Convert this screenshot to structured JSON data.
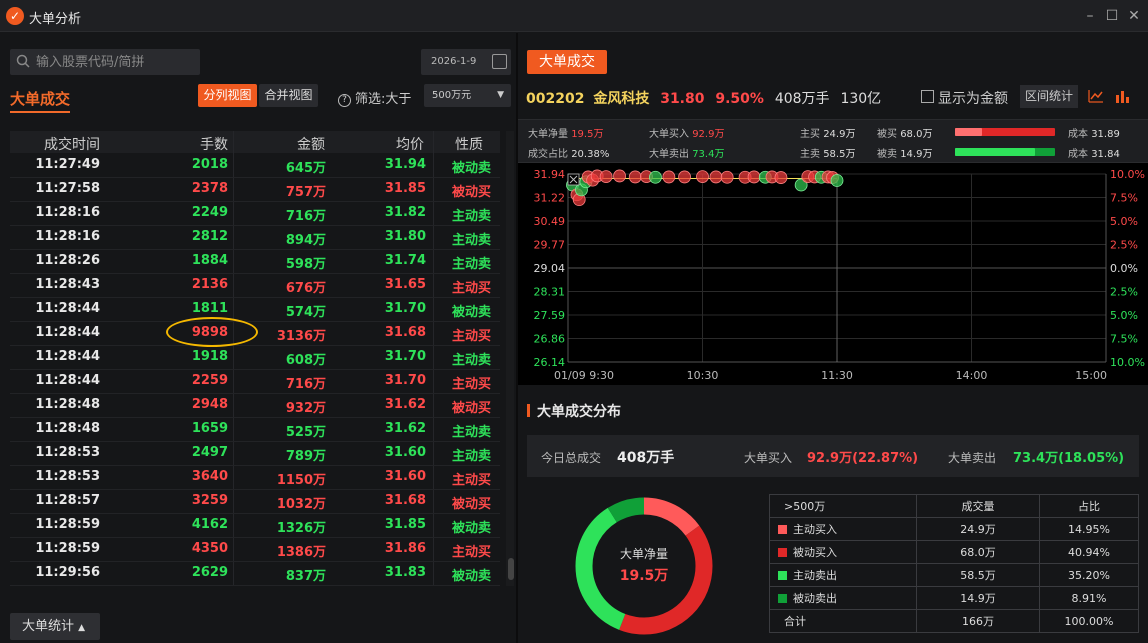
{
  "window": {
    "title": "大单分析",
    "logo_glyph": "✓",
    "controls": [
      "–",
      "☐",
      "✕"
    ]
  },
  "left": {
    "search": {
      "placeholder": "输入股票代码/简拼"
    },
    "date": "2026-1-9",
    "title": "大单成交",
    "view_split": "分列视图",
    "view_merge": "合并视图",
    "filter_label": "筛选:大于",
    "filter_value": "500万元",
    "columns": [
      "成交时间",
      "手数",
      "金额",
      "均价",
      "性质"
    ],
    "rows": [
      {
        "time": "11:27:49",
        "vol": "2018",
        "amt": "645万",
        "price": "31.94",
        "kind": "被动卖",
        "c": "green"
      },
      {
        "time": "11:27:58",
        "vol": "2378",
        "amt": "757万",
        "price": "31.85",
        "kind": "被动买",
        "c": "red"
      },
      {
        "time": "11:28:16",
        "vol": "2249",
        "amt": "716万",
        "price": "31.82",
        "kind": "主动卖",
        "c": "green"
      },
      {
        "time": "11:28:16",
        "vol": "2812",
        "amt": "894万",
        "price": "31.80",
        "kind": "主动卖",
        "c": "green"
      },
      {
        "time": "11:28:26",
        "vol": "1884",
        "amt": "598万",
        "price": "31.74",
        "kind": "主动卖",
        "c": "green"
      },
      {
        "time": "11:28:43",
        "vol": "2136",
        "amt": "676万",
        "price": "31.65",
        "kind": "主动买",
        "c": "red"
      },
      {
        "time": "11:28:44",
        "vol": "1811",
        "amt": "574万",
        "price": "31.70",
        "kind": "被动卖",
        "c": "green"
      },
      {
        "time": "11:28:44",
        "vol": "9898",
        "amt": "3136万",
        "price": "31.68",
        "kind": "主动买",
        "c": "red"
      },
      {
        "time": "11:28:44",
        "vol": "1918",
        "amt": "608万",
        "price": "31.70",
        "kind": "主动卖",
        "c": "green"
      },
      {
        "time": "11:28:44",
        "vol": "2259",
        "amt": "716万",
        "price": "31.70",
        "kind": "主动买",
        "c": "red"
      },
      {
        "time": "11:28:48",
        "vol": "2948",
        "amt": "932万",
        "price": "31.62",
        "kind": "被动买",
        "c": "red"
      },
      {
        "time": "11:28:48",
        "vol": "1659",
        "amt": "525万",
        "price": "31.62",
        "kind": "主动卖",
        "c": "green"
      },
      {
        "time": "11:28:53",
        "vol": "2497",
        "amt": "789万",
        "price": "31.60",
        "kind": "主动卖",
        "c": "green"
      },
      {
        "time": "11:28:53",
        "vol": "3640",
        "amt": "1150万",
        "price": "31.60",
        "kind": "主动买",
        "c": "red"
      },
      {
        "time": "11:28:57",
        "vol": "3259",
        "amt": "1032万",
        "price": "31.68",
        "kind": "被动买",
        "c": "red"
      },
      {
        "time": "11:28:59",
        "vol": "4162",
        "amt": "1326万",
        "price": "31.85",
        "kind": "被动卖",
        "c": "green"
      },
      {
        "time": "11:28:59",
        "vol": "4350",
        "amt": "1386万",
        "price": "31.86",
        "kind": "主动买",
        "c": "red"
      },
      {
        "time": "11:29:56",
        "vol": "2629",
        "amt": "837万",
        "price": "31.83",
        "kind": "被动卖",
        "c": "green"
      }
    ],
    "stat_button": "大单统计"
  },
  "right": {
    "title_button": "大单成交",
    "stock": {
      "code": "002202",
      "name": "金风科技",
      "price": "31.80",
      "change": "9.50%",
      "volume": "408万手",
      "cap": "130亿"
    },
    "show_amount_label": "显示为金额",
    "range_stat_label": "区间统计",
    "info": {
      "net_label": "大单净量",
      "net": "19.5万",
      "ratio_label": "成交占比",
      "ratio": "20.38%",
      "buy_label": "大单买入",
      "buy": "92.9万",
      "sell_label": "大单卖出",
      "sell": "73.4万",
      "active_buy_label": "主买",
      "active_buy": "24.9万",
      "passive_buy_label": "被买",
      "passive_buy": "68.0万",
      "active_sell_label": "主卖",
      "active_sell": "58.5万",
      "passive_sell_label": "被卖",
      "passive_sell": "14.9万",
      "cost_label": "成本",
      "cost_buy": "31.89",
      "cost_sell": "31.84",
      "buy_bar_active_fraction": 0.27,
      "sell_bar_active_fraction": 0.8
    },
    "chart_data": {
      "type": "scatter",
      "y_ticks": [
        "31.94",
        "31.22",
        "30.49",
        "29.77",
        "29.04",
        "28.31",
        "27.59",
        "26.86",
        "26.14"
      ],
      "pct_ticks": [
        "10.0%",
        "7.5%",
        "5.0%",
        "2.5%",
        "0.0%",
        "2.5%",
        "5.0%",
        "7.5%",
        "10.0%"
      ],
      "x_ticks": [
        "01/09 9:30",
        "10:30",
        "11:30",
        "14:00",
        "15:00"
      ],
      "ylim": [
        26.14,
        31.94
      ],
      "xlim": [
        0,
        240
      ],
      "price_line": 31.8,
      "points": [
        {
          "t": 2,
          "p": 31.6,
          "s": "sell"
        },
        {
          "t": 4,
          "p": 31.3,
          "s": "buy"
        },
        {
          "t": 5,
          "p": 31.15,
          "s": "buy"
        },
        {
          "t": 6,
          "p": 31.45,
          "s": "sell"
        },
        {
          "t": 8,
          "p": 31.7,
          "s": "sell"
        },
        {
          "t": 9,
          "p": 31.85,
          "s": "buy"
        },
        {
          "t": 11,
          "p": 31.75,
          "s": "buy"
        },
        {
          "t": 13,
          "p": 31.88,
          "s": "buy"
        },
        {
          "t": 17,
          "p": 31.86,
          "s": "buy"
        },
        {
          "t": 23,
          "p": 31.88,
          "s": "buy"
        },
        {
          "t": 30,
          "p": 31.85,
          "s": "buy"
        },
        {
          "t": 35,
          "p": 31.86,
          "s": "buy"
        },
        {
          "t": 39,
          "p": 31.84,
          "s": "sell"
        },
        {
          "t": 45,
          "p": 31.85,
          "s": "buy"
        },
        {
          "t": 52,
          "p": 31.85,
          "s": "buy"
        },
        {
          "t": 60,
          "p": 31.86,
          "s": "buy"
        },
        {
          "t": 66,
          "p": 31.85,
          "s": "buy"
        },
        {
          "t": 71,
          "p": 31.84,
          "s": "buy"
        },
        {
          "t": 79,
          "p": 31.84,
          "s": "buy"
        },
        {
          "t": 83,
          "p": 31.85,
          "s": "buy"
        },
        {
          "t": 88,
          "p": 31.84,
          "s": "sell"
        },
        {
          "t": 91,
          "p": 31.85,
          "s": "buy"
        },
        {
          "t": 95,
          "p": 31.83,
          "s": "buy"
        },
        {
          "t": 104,
          "p": 31.6,
          "s": "sell"
        },
        {
          "t": 107,
          "p": 31.86,
          "s": "buy"
        },
        {
          "t": 110,
          "p": 31.85,
          "s": "buy"
        },
        {
          "t": 113,
          "p": 31.84,
          "s": "sell"
        },
        {
          "t": 116,
          "p": 31.85,
          "s": "buy"
        },
        {
          "t": 118,
          "p": 31.83,
          "s": "buy"
        },
        {
          "t": 120,
          "p": 31.74,
          "s": "sell"
        }
      ]
    },
    "dist_title": "大单成交分布",
    "summary": {
      "total_label": "今日总成交",
      "total": "408万手",
      "buy_label": "大单买入",
      "buy": "92.9万(22.87%)",
      "sell_label": "大单卖出",
      "sell": "73.4万(18.05%)"
    },
    "donut": {
      "center_label": "大单净量",
      "center_value": "19.5万"
    },
    "dist_table": {
      "headers": [
        ">500万",
        "成交量",
        "占比"
      ],
      "rows": [
        {
          "name": "主动买入",
          "vol": "24.9万",
          "pct": "14.95%",
          "color": "#ff5a5a",
          "share": 14.95
        },
        {
          "name": "被动买入",
          "vol": "68.0万",
          "pct": "40.94%",
          "color": "#e02828",
          "share": 40.94
        },
        {
          "name": "主动卖出",
          "vol": "58.5万",
          "pct": "35.20%",
          "color": "#2ee25a",
          "share": 35.2
        },
        {
          "name": "被动卖出",
          "vol": "14.9万",
          "pct": "8.91%",
          "color": "#10a038",
          "share": 8.91
        }
      ],
      "total_row": {
        "name": "合计",
        "vol": "166万",
        "pct": "100.00%"
      }
    }
  }
}
